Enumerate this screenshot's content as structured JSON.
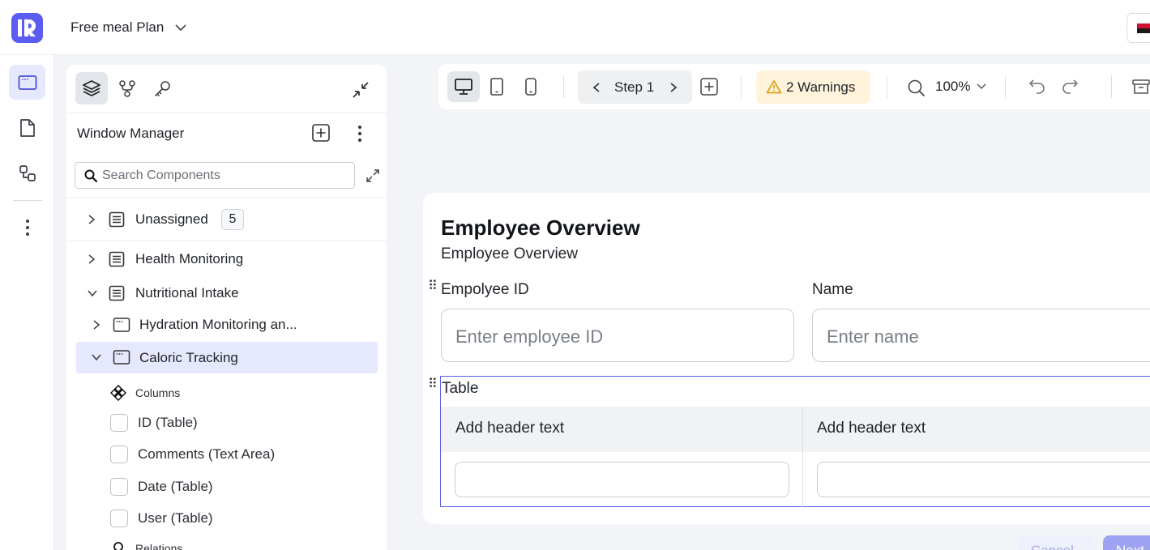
{
  "app": {
    "project_name": "Free meal Plan"
  },
  "side_panel": {
    "section_title": "Window Manager",
    "search_placeholder": "Search Components",
    "tree": {
      "unassigned_label": "Unassigned",
      "unassigned_count": "5",
      "health_label": "Health Monitoring",
      "nutrition_label": "Nutritional Intake",
      "hydration_label": "Hydration Monitoring an...",
      "caloric_label": "Caloric Tracking",
      "columns_label": "Columns",
      "fields": [
        "ID (Table)",
        "Comments (Text Area)",
        "Date (Table)",
        "User (Table)"
      ],
      "relations_label": "Relations"
    }
  },
  "toolbar": {
    "step_label": "Step 1",
    "warnings_label": "2 Warnings",
    "zoom_label": "100%"
  },
  "form": {
    "title": "Employee Overview",
    "subtitle": "Employee Overview",
    "field1_label": "Empolyee ID",
    "field1_placeholder": "Enter employee ID",
    "field2_label": "Name",
    "field2_placeholder": "Enter name",
    "table_label": "Table",
    "table_headers": [
      "Add header text",
      "Add header text"
    ],
    "cancel_label": "Cancel",
    "next_label": "Next"
  },
  "colors": {
    "accent": "#5a5df0",
    "warning_bg": "#fff3dc",
    "selected_bg": "#e6e8fd"
  }
}
